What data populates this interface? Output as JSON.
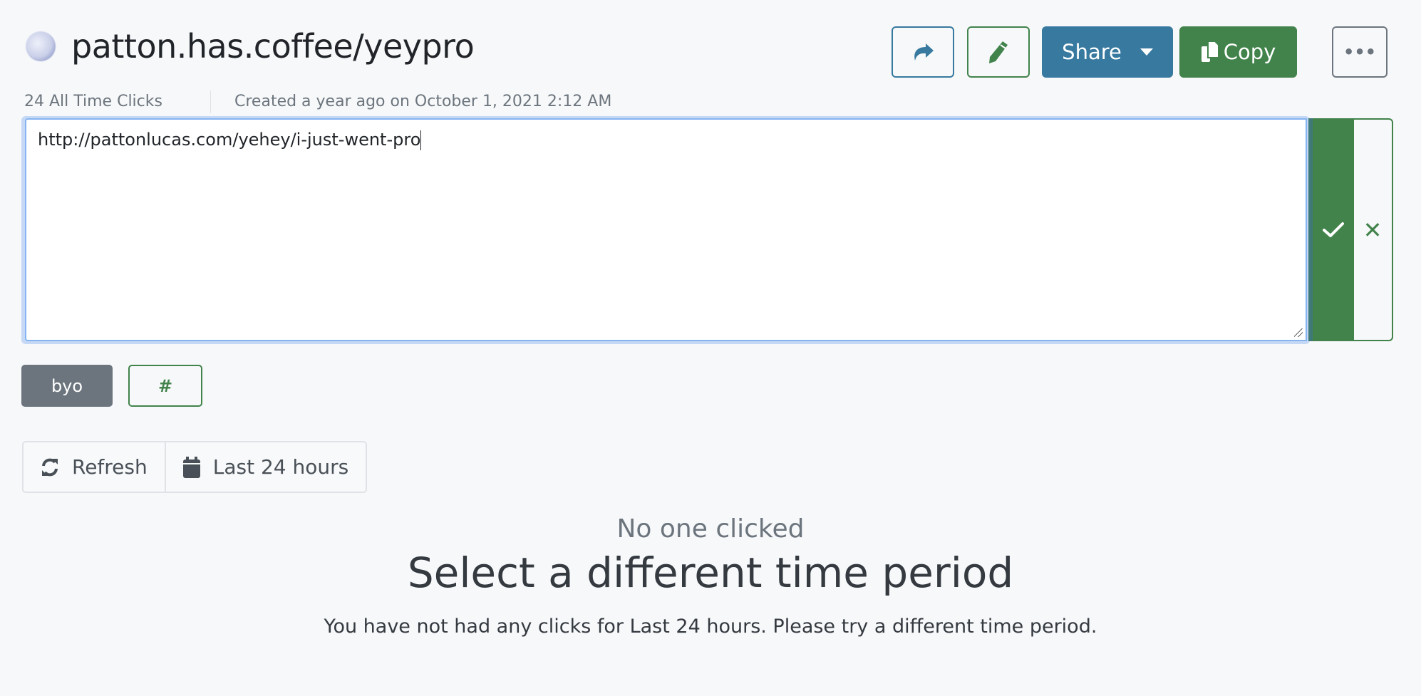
{
  "header": {
    "title": "patton.has.coffee/yeypro",
    "favicon": "globe-icon",
    "all_time_clicks": "24 All Time Clicks",
    "created": "Created a year ago on October 1, 2021 2:12 AM"
  },
  "toolbar": {
    "redirect_icon": "share-arrow-icon",
    "edit_icon": "pencil-icon",
    "share_label": "Share",
    "copy_label": "Copy",
    "more_label": "•••"
  },
  "editor": {
    "value": "http://pattonlucas.com/yehey/i-just-went-pro",
    "confirm_icon": "check-icon",
    "cancel_label": "✕"
  },
  "tags": {
    "items": [
      "byo"
    ],
    "add_label": "#"
  },
  "controls": {
    "refresh_label": "Refresh",
    "period_label": "Last 24 hours"
  },
  "empty_state": {
    "subtitle": "No one clicked",
    "title": "Select a different time period",
    "message": "You have not had any clicks for Last 24 hours. Please try a different time period."
  },
  "colors": {
    "primary": "#37799f",
    "success": "#41834b",
    "secondary": "#6c757d",
    "background": "#f7f8fa"
  }
}
